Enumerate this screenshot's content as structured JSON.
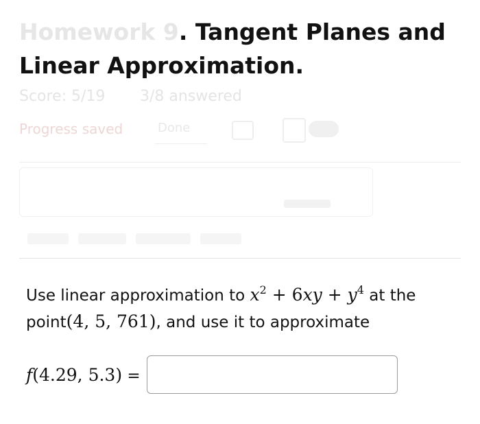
{
  "header": {
    "title_faded_part": "Homework 9",
    "title_visible_part": ". Tangent Planes and Linear Approximation.",
    "score": "Score: 5/19",
    "answered": "3/8 answered",
    "progress_label": "Progress saved",
    "done_label": "Done"
  },
  "question": {
    "intro": "Use linear approximation to ",
    "func_x": "x",
    "func_exp1": "2",
    "func_mid": " + 6",
    "func_xy": "xy",
    "func_plus": " + ",
    "func_y": "y",
    "func_exp2": "4",
    "after_func": " at the point",
    "point": "(4, 5, 761)",
    "tail": ", and use it to approximate"
  },
  "evaluate": {
    "f": "f",
    "args": "(4.29, 5.3)",
    "equals": " =",
    "value": "",
    "placeholder": ""
  },
  "colors": {
    "text": "#111111",
    "faded": "#e6e6e6",
    "input_border": "#9a9a9a"
  }
}
